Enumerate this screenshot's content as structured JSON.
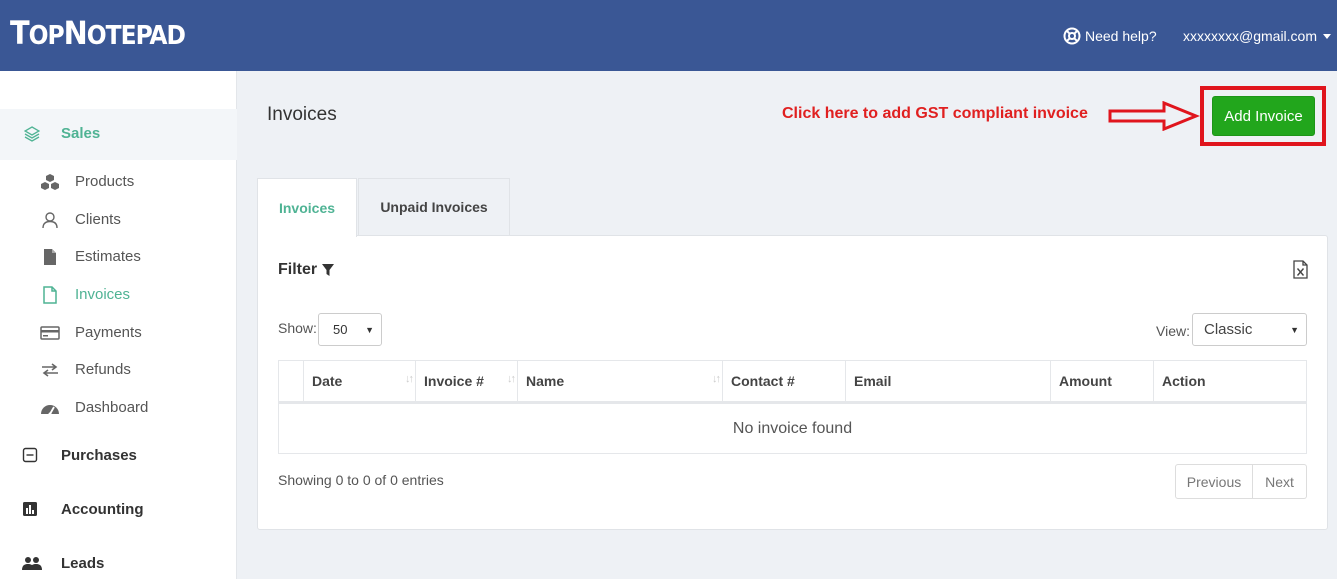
{
  "header": {
    "logo_first": "T",
    "logo_rest1": "OP",
    "logo_mid": "N",
    "logo_rest2": "OTEPAD",
    "help_label": "Need help?",
    "user_email": "xxxxxxxx@gmail.com"
  },
  "sidebar": {
    "sales": "Sales",
    "items": [
      {
        "label": "Products",
        "icon": "cubes-icon"
      },
      {
        "label": "Clients",
        "icon": "user-icon"
      },
      {
        "label": "Estimates",
        "icon": "file-icon"
      },
      {
        "label": "Invoices",
        "icon": "document-icon",
        "active": true
      },
      {
        "label": "Payments",
        "icon": "credit-card-icon"
      },
      {
        "label": "Refunds",
        "icon": "exchange-icon"
      },
      {
        "label": "Dashboard",
        "icon": "dashboard-icon"
      }
    ],
    "purchases": "Purchases",
    "accounting": "Accounting",
    "leads": "Leads"
  },
  "main": {
    "title": "Invoices",
    "promo": "Click here to add GST compliant invoice",
    "add_button": "Add Invoice",
    "tabs": [
      {
        "label": "Invoices",
        "active": true
      },
      {
        "label": "Unpaid Invoices",
        "active": false
      }
    ],
    "filter_label": "Filter",
    "show_label": "Show:",
    "show_value": "50",
    "view_label": "View:",
    "view_value": "Classic",
    "columns": [
      "",
      "Date",
      "Invoice #",
      "Name",
      "Contact #",
      "Email",
      "Amount",
      "Action"
    ],
    "empty_message": "No invoice found",
    "showing": "Showing 0 to 0 of 0 entries",
    "prev": "Previous",
    "next": "Next"
  },
  "colors": {
    "topbar": "#3a5795",
    "accent": "#4fb394",
    "add_button": "#22a61c",
    "highlight": "#e0151d"
  }
}
